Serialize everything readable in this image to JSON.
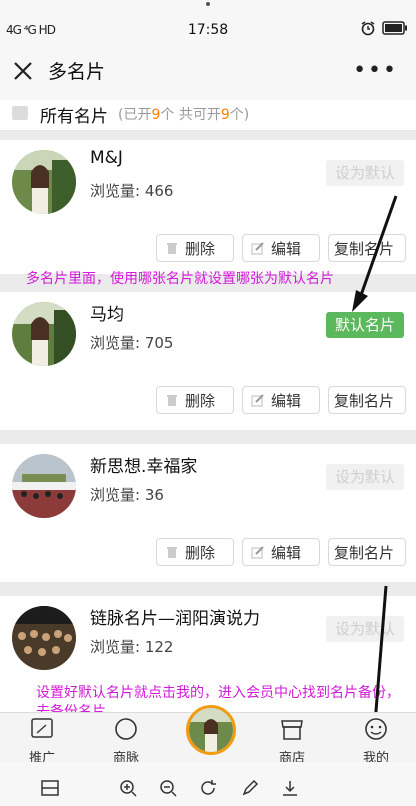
{
  "status_bar": {
    "signal": "4G ⁴G HD",
    "time": "17:58"
  },
  "title_bar": {
    "title": "多名片"
  },
  "header": {
    "label": "所有名片",
    "info_pre": "(已开",
    "opened": "9",
    "info_mid": "个 共可开",
    "total": "9",
    "info_post": "个)"
  },
  "cards": [
    {
      "name": "M&J",
      "views": "浏览量: 466",
      "default_label": "设为默认",
      "is_default": false
    },
    {
      "name": "马均",
      "views": "浏览量: 705",
      "default_label": "默认名片",
      "is_default": true
    },
    {
      "name": "新思想.幸福家",
      "views": "浏览量: 36",
      "default_label": "设为默认",
      "is_default": false
    },
    {
      "name": "链脉名片—润阳演说力",
      "views": "浏览量: 122",
      "default_label": "设为默认",
      "is_default": false
    }
  ],
  "card_actions": {
    "delete": "删除",
    "edit": "编辑",
    "copy": "复制名片"
  },
  "annotations": {
    "top": "多名片里面，使用哪张名片就设置哪张为默认名片",
    "bottom": "设置好默认名片就点击我的，进入会员中心找到名片备份，去备份名片"
  },
  "tab_bar": {
    "tabs": [
      "推广",
      "商脉",
      "",
      "商店",
      "我的"
    ]
  },
  "colors": {
    "accent_green": "#5cb85c",
    "annotation": "#d21bd8",
    "highlight_orange": "#ff7e00",
    "center_ring": "#f39c12"
  }
}
